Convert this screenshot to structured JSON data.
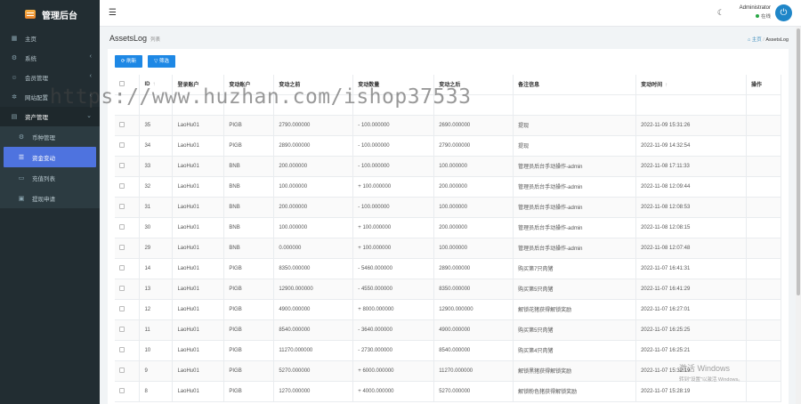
{
  "brand": {
    "title": "管理后台"
  },
  "sidebar": {
    "items": [
      {
        "label": "主页",
        "icon": "dashboard-icon",
        "has_arrow": false
      },
      {
        "label": "系统",
        "icon": "gear-icon",
        "has_arrow": true
      },
      {
        "label": "会员管理",
        "icon": "users-icon",
        "has_arrow": true
      },
      {
        "label": "网站配置",
        "icon": "cog-icon",
        "has_arrow": true
      },
      {
        "label": "资产管理",
        "icon": "assets-icon",
        "has_arrow": true,
        "open": true
      }
    ],
    "sub_items": [
      {
        "label": "币种管理",
        "icon": "coin-icon",
        "active": false
      },
      {
        "label": "资金变动",
        "icon": "list-icon",
        "active": true
      },
      {
        "label": "充值列表",
        "icon": "deposit-icon",
        "active": false
      },
      {
        "label": "提现申请",
        "icon": "withdraw-icon",
        "active": false
      }
    ]
  },
  "topbar": {
    "user_name": "Administrator",
    "user_status": "在线"
  },
  "page": {
    "title": "AssetsLog",
    "subtitle": "列表",
    "breadcrumb_home": "主页",
    "breadcrumb_current": "AssetsLog"
  },
  "toolbar": {
    "refresh": "刷新",
    "filter": "筛选"
  },
  "table": {
    "headers": [
      "",
      "ID",
      "登录账户",
      "变动账户",
      "变动之前",
      "变动数量",
      "变动之后",
      "备注信息",
      "变动时间",
      "操作"
    ],
    "rows": [
      [
        "",
        "",
        "",
        "",
        "",
        "",
        "",
        "",
        "",
        ""
      ],
      [
        "35",
        "LaoHu01",
        "PIGB",
        "2790.000000",
        "- 100.000000",
        "2690.000000",
        "提现",
        "2022-11-09 15:31:26"
      ],
      [
        "34",
        "LaoHu01",
        "PIGB",
        "2890.000000",
        "- 100.000000",
        "2790.000000",
        "提现",
        "2022-11-09 14:32:54"
      ],
      [
        "33",
        "LaoHu01",
        "BNB",
        "200.000000",
        "- 100.000000",
        "100.000000",
        "管理员后台手动操作-admin",
        "2022-11-08 17:11:33"
      ],
      [
        "32",
        "LaoHu01",
        "BNB",
        "100.000000",
        "+ 100.000000",
        "200.000000",
        "管理员后台手动操作-admin",
        "2022-11-08 12:09:44"
      ],
      [
        "31",
        "LaoHu01",
        "BNB",
        "200.000000",
        "- 100.000000",
        "100.000000",
        "管理员后台手动操作-admin",
        "2022-11-08 12:08:53"
      ],
      [
        "30",
        "LaoHu01",
        "BNB",
        "100.000000",
        "+ 100.000000",
        "200.000000",
        "管理员后台手动操作-admin",
        "2022-11-08 12:08:15"
      ],
      [
        "29",
        "LaoHu01",
        "BNB",
        "0.000000",
        "+ 100.000000",
        "100.000000",
        "管理员后台手动操作-admin",
        "2022-11-08 12:07:48"
      ],
      [
        "14",
        "LaoHu01",
        "PIGB",
        "8350.000000",
        "- 5460.000000",
        "2890.000000",
        "购买第7只肉猪",
        "2022-11-07 16:41:31"
      ],
      [
        "13",
        "LaoHu01",
        "PIGB",
        "12900.000000",
        "- 4550.000000",
        "8350.000000",
        "购买第5只肉猪",
        "2022-11-07 16:41:29"
      ],
      [
        "12",
        "LaoHu01",
        "PIGB",
        "4900.000000",
        "+ 8000.000000",
        "12900.000000",
        "解锁花猪获得解锁奖励",
        "2022-11-07 16:27:01"
      ],
      [
        "11",
        "LaoHu01",
        "PIGB",
        "8540.000000",
        "- 3640.000000",
        "4900.000000",
        "购买第5只肉猪",
        "2022-11-07 16:25:25"
      ],
      [
        "10",
        "LaoHu01",
        "PIGB",
        "11270.000000",
        "- 2730.000000",
        "8540.000000",
        "购买第4只肉猪",
        "2022-11-07 16:25:21"
      ],
      [
        "9",
        "LaoHu01",
        "PIGB",
        "5270.000000",
        "+ 6000.000000",
        "11270.000000",
        "解锁黑猪获得解锁奖励",
        "2022-11-07 15:32:19"
      ],
      [
        "8",
        "LaoHu01",
        "PIGB",
        "1270.000000",
        "+ 4000.000000",
        "5270.000000",
        "解锁粉色猪获得解锁奖励",
        "2022-11-07 15:28:19"
      ]
    ]
  },
  "overlay": {
    "watermark": "https://www.huzhan.com/ishop37533",
    "activate_title": "激活 Windows",
    "activate_sub": "转到\"设置\"以激活 Windows。"
  }
}
